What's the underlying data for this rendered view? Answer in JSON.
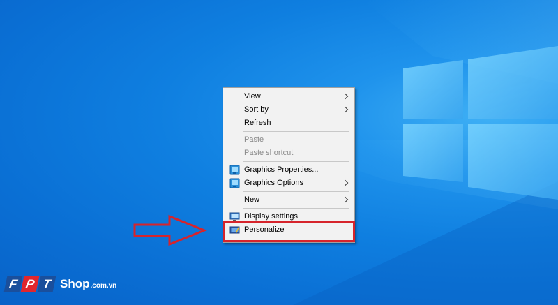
{
  "desktop": {
    "wallpaper_colors": {
      "base": "#0a6fd4",
      "glow": "#3fb0f5",
      "pane": "#4fc0f8"
    }
  },
  "context_menu": {
    "items": [
      {
        "label": "View",
        "submenu": true,
        "disabled": false,
        "icon": null
      },
      {
        "label": "Sort by",
        "submenu": true,
        "disabled": false,
        "icon": null
      },
      {
        "label": "Refresh",
        "submenu": false,
        "disabled": false,
        "icon": null
      },
      {
        "label": "Paste",
        "submenu": false,
        "disabled": true,
        "icon": null
      },
      {
        "label": "Paste shortcut",
        "submenu": false,
        "disabled": true,
        "icon": null
      },
      {
        "label": "Graphics Properties...",
        "submenu": false,
        "disabled": false,
        "icon": "intel-graphics-icon"
      },
      {
        "label": "Graphics Options",
        "submenu": true,
        "disabled": false,
        "icon": "intel-graphics-icon"
      },
      {
        "label": "New",
        "submenu": true,
        "disabled": false,
        "icon": null
      },
      {
        "label": "Display settings",
        "submenu": false,
        "disabled": false,
        "icon": "display-icon"
      },
      {
        "label": "Personalize",
        "submenu": false,
        "disabled": false,
        "icon": "personalize-icon",
        "highlighted": true
      }
    ]
  },
  "annotation": {
    "highlight_color": "#d6242c",
    "arrow_color": "#d6242c",
    "arrow_target": "Personalize"
  },
  "watermark": {
    "letters": [
      "F",
      "P",
      "T"
    ],
    "letter_colors": [
      "#1a4f9c",
      "#e1262d",
      "#1a4f9c"
    ],
    "brand": "Shop",
    "domain": ".com.vn"
  }
}
